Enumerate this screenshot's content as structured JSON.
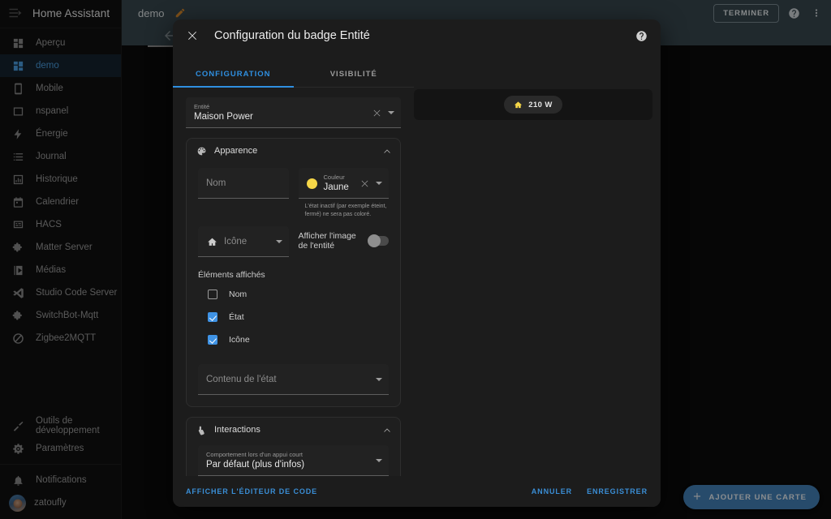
{
  "sidebar": {
    "title": "Home Assistant",
    "items": [
      {
        "label": "Aperçu",
        "icon": "dashboard-icon",
        "active": false
      },
      {
        "label": "demo",
        "icon": "dashboard-icon",
        "active": true
      },
      {
        "label": "Mobile",
        "icon": "phone-icon",
        "active": false
      },
      {
        "label": "nspanel",
        "icon": "tablet-icon",
        "active": false
      },
      {
        "label": "Énergie",
        "icon": "lightning-icon",
        "active": false
      },
      {
        "label": "Journal",
        "icon": "list-icon",
        "active": false
      },
      {
        "label": "Historique",
        "icon": "chart-icon",
        "active": false
      },
      {
        "label": "Calendrier",
        "icon": "calendar-icon",
        "active": false
      },
      {
        "label": "HACS",
        "icon": "hacs-icon",
        "active": false
      },
      {
        "label": "Matter Server",
        "icon": "puzzle-icon",
        "active": false
      },
      {
        "label": "Médias",
        "icon": "media-icon",
        "active": false
      },
      {
        "label": "Studio Code Server",
        "icon": "vscode-icon",
        "active": false
      },
      {
        "label": "SwitchBot-Mqtt",
        "icon": "puzzle-icon",
        "active": false
      },
      {
        "label": "Zigbee2MQTT",
        "icon": "zigbee-icon",
        "active": false
      }
    ],
    "bottom_items": [
      {
        "label": "Outils de développement",
        "icon": "hammer-icon"
      },
      {
        "label": "Paramètres",
        "icon": "gear-icon"
      }
    ],
    "notifications_label": "Notifications",
    "user_label": "zatoufly"
  },
  "topbar": {
    "view_name": "demo",
    "edit_icon": "pencil-icon",
    "done_label": "TERMINER",
    "help_icon": "help-circle-icon",
    "overflow_icon": "dots-vertical-icon"
  },
  "fab": {
    "label": "AJOUTER UNE CARTE",
    "icon": "plus-icon"
  },
  "dialog": {
    "title": "Configuration du badge Entité",
    "close_icon": "close-icon",
    "help_icon": "help-circle-icon",
    "tabs": [
      {
        "label": "CONFIGURATION",
        "active": true
      },
      {
        "label": "VISIBILITÉ",
        "active": false
      }
    ],
    "entity_field": {
      "label": "Entité",
      "value": "Maison Power",
      "clear_icon": "close-icon",
      "dropdown_icon": "chevron-down-icon"
    },
    "appearance": {
      "title": "Apparence",
      "icon": "palette-icon",
      "collapse_icon": "chevron-up-icon",
      "name_field": {
        "placeholder": "Nom",
        "value": ""
      },
      "color_field": {
        "label": "Couleur",
        "value": "Jaune",
        "swatch_color": "#f5d648",
        "clear_icon": "close-icon",
        "dropdown_icon": "chevron-down-icon"
      },
      "color_helper": "L'état inactif (par exemple éteint, fermé) ne sera pas coloré.",
      "icon_field": {
        "placeholder": "Icône",
        "icon": "home-icon",
        "dropdown_icon": "chevron-down-icon"
      },
      "entity_picture_toggle": {
        "label": "Afficher l'image de l'entité",
        "checked": false
      },
      "displayed_elements_title": "Éléments affichés",
      "displayed_elements": [
        {
          "label": "Nom",
          "checked": false
        },
        {
          "label": "État",
          "checked": true
        },
        {
          "label": "Icône",
          "checked": true
        }
      ],
      "state_content_field": {
        "placeholder": "Contenu de l'état",
        "dropdown_icon": "chevron-down-icon"
      }
    },
    "interactions": {
      "title": "Interactions",
      "icon": "tap-icon",
      "collapse_icon": "chevron-up-icon",
      "tap_behavior": {
        "label": "Comportement lors d'un appui court",
        "value": "Par défaut (plus d'infos)",
        "dropdown_icon": "chevron-down-icon"
      }
    },
    "preview": {
      "badge_icon": "home-icon",
      "badge_text": "210 W",
      "badge_icon_color": "#f5d648"
    },
    "footer": {
      "code_editor_label": "AFFICHER L'ÉDITEUR DE CODE",
      "cancel_label": "ANNULER",
      "save_label": "ENREGISTRER"
    }
  },
  "colors": {
    "accent": "#2f8fe0",
    "toolbar": "#37474f",
    "dialog_bg": "#1c1c1c",
    "yellow": "#f5d648"
  }
}
